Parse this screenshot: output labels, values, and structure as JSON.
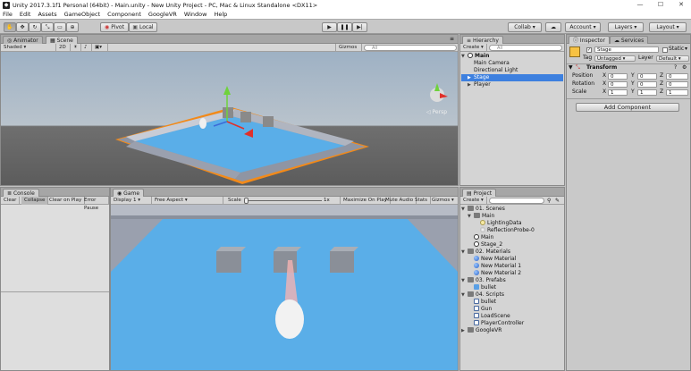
{
  "window": {
    "title": "Unity 2017.3.1f1 Personal (64bit) - Main.unity - New Unity Project - PC, Mac & Linux Standalone <DX11>",
    "minimize": "—",
    "maximize": "☐",
    "close": "✕"
  },
  "menu": [
    "File",
    "Edit",
    "Assets",
    "GameObject",
    "Component",
    "GoogleVR",
    "Window",
    "Help"
  ],
  "toolbar": {
    "pivot": "Pivot",
    "local": "Local",
    "collab": "Collab ▾",
    "account": "Account",
    "layers": "Layers",
    "layout": "Layout"
  },
  "scene_panel": {
    "tabs": [
      "Animator",
      "Scene"
    ],
    "shading": "Shaded",
    "mode_2d": "2D",
    "gizmos": "Gizmos ▾",
    "search_placeholder": "All",
    "persp": "Persp"
  },
  "console_panel": {
    "tab": "Console",
    "buttons": [
      "Clear",
      "Collapse",
      "Clear on Play",
      "Error Pause"
    ]
  },
  "game_panel": {
    "tab": "Game",
    "display": "Display 1",
    "aspect": "Free Aspect",
    "scale_label": "Scale",
    "scale_value": "1x",
    "options": [
      "Maximize On Play",
      "Mute Audio",
      "Stats",
      "Gizmos ▾"
    ]
  },
  "hierarchy": {
    "tab": "Hierarchy",
    "create": "Create ▾",
    "search_placeholder": "All",
    "items": [
      {
        "label": "Main",
        "indent": 0,
        "arrow": "▼",
        "icon": "unity",
        "bold": true
      },
      {
        "label": "Main Camera",
        "indent": 1,
        "arrow": "",
        "icon": "",
        "bold": false
      },
      {
        "label": "Directional Light",
        "indent": 1,
        "arrow": "",
        "icon": "",
        "bold": false
      },
      {
        "label": "Stage",
        "indent": 1,
        "arrow": "▶",
        "icon": "",
        "bold": false,
        "selected": true
      },
      {
        "label": "Player",
        "indent": 1,
        "arrow": "▶",
        "icon": "",
        "bold": false
      }
    ]
  },
  "project": {
    "tab": "Project",
    "create": "Create ▾",
    "items": [
      {
        "label": "01. Scenes",
        "indent": 0,
        "arrow": "▼",
        "icon": "folder"
      },
      {
        "label": "Main",
        "indent": 1,
        "arrow": "▼",
        "icon": "folder"
      },
      {
        "label": "LightingData",
        "indent": 2,
        "arrow": "",
        "icon": "light"
      },
      {
        "label": "ReflectionProbe-0",
        "indent": 2,
        "arrow": "",
        "icon": "probe"
      },
      {
        "label": "Main",
        "indent": 1,
        "arrow": "",
        "icon": "unity"
      },
      {
        "label": "Stage_2",
        "indent": 1,
        "arrow": "",
        "icon": "unity"
      },
      {
        "label": "02. Materials",
        "indent": 0,
        "arrow": "▼",
        "icon": "folder"
      },
      {
        "label": "New Material",
        "indent": 1,
        "arrow": "",
        "icon": "mat"
      },
      {
        "label": "New Material 1",
        "indent": 1,
        "arrow": "",
        "icon": "mat"
      },
      {
        "label": "New Material 2",
        "indent": 1,
        "arrow": "",
        "icon": "mat"
      },
      {
        "label": "03. Prefabs",
        "indent": 0,
        "arrow": "▼",
        "icon": "folder"
      },
      {
        "label": "bullet",
        "indent": 1,
        "arrow": "",
        "icon": "prefab"
      },
      {
        "label": "04. Scripts",
        "indent": 0,
        "arrow": "▼",
        "icon": "folder"
      },
      {
        "label": "bullet",
        "indent": 1,
        "arrow": "",
        "icon": "script"
      },
      {
        "label": "Gun",
        "indent": 1,
        "arrow": "",
        "icon": "script"
      },
      {
        "label": "LoadScene",
        "indent": 1,
        "arrow": "",
        "icon": "script"
      },
      {
        "label": "PlayerController",
        "indent": 1,
        "arrow": "",
        "icon": "script"
      },
      {
        "label": "GoogleVR",
        "indent": 0,
        "arrow": "▶",
        "icon": "folder"
      }
    ]
  },
  "inspector": {
    "tabs": [
      "Inspector",
      "Services"
    ],
    "object_name": "Stage",
    "static_label": "Static",
    "tag_label": "Tag",
    "tag_value": "Untagged",
    "layer_label": "Layer",
    "layer_value": "Default",
    "transform_title": "Transform",
    "position_label": "Position",
    "rotation_label": "Rotation",
    "scale_label": "Scale",
    "position": {
      "x": "0",
      "y": "0",
      "z": "0"
    },
    "rotation": {
      "x": "0",
      "y": "0",
      "z": "0"
    },
    "scale": {
      "x": "1",
      "y": "1",
      "z": "1"
    },
    "add_component": "Add Component"
  },
  "colors": {
    "selection": "#3d80df",
    "outline": "#f28a1a",
    "floor": "#5aaee8",
    "wall": "#9aa0ae"
  }
}
